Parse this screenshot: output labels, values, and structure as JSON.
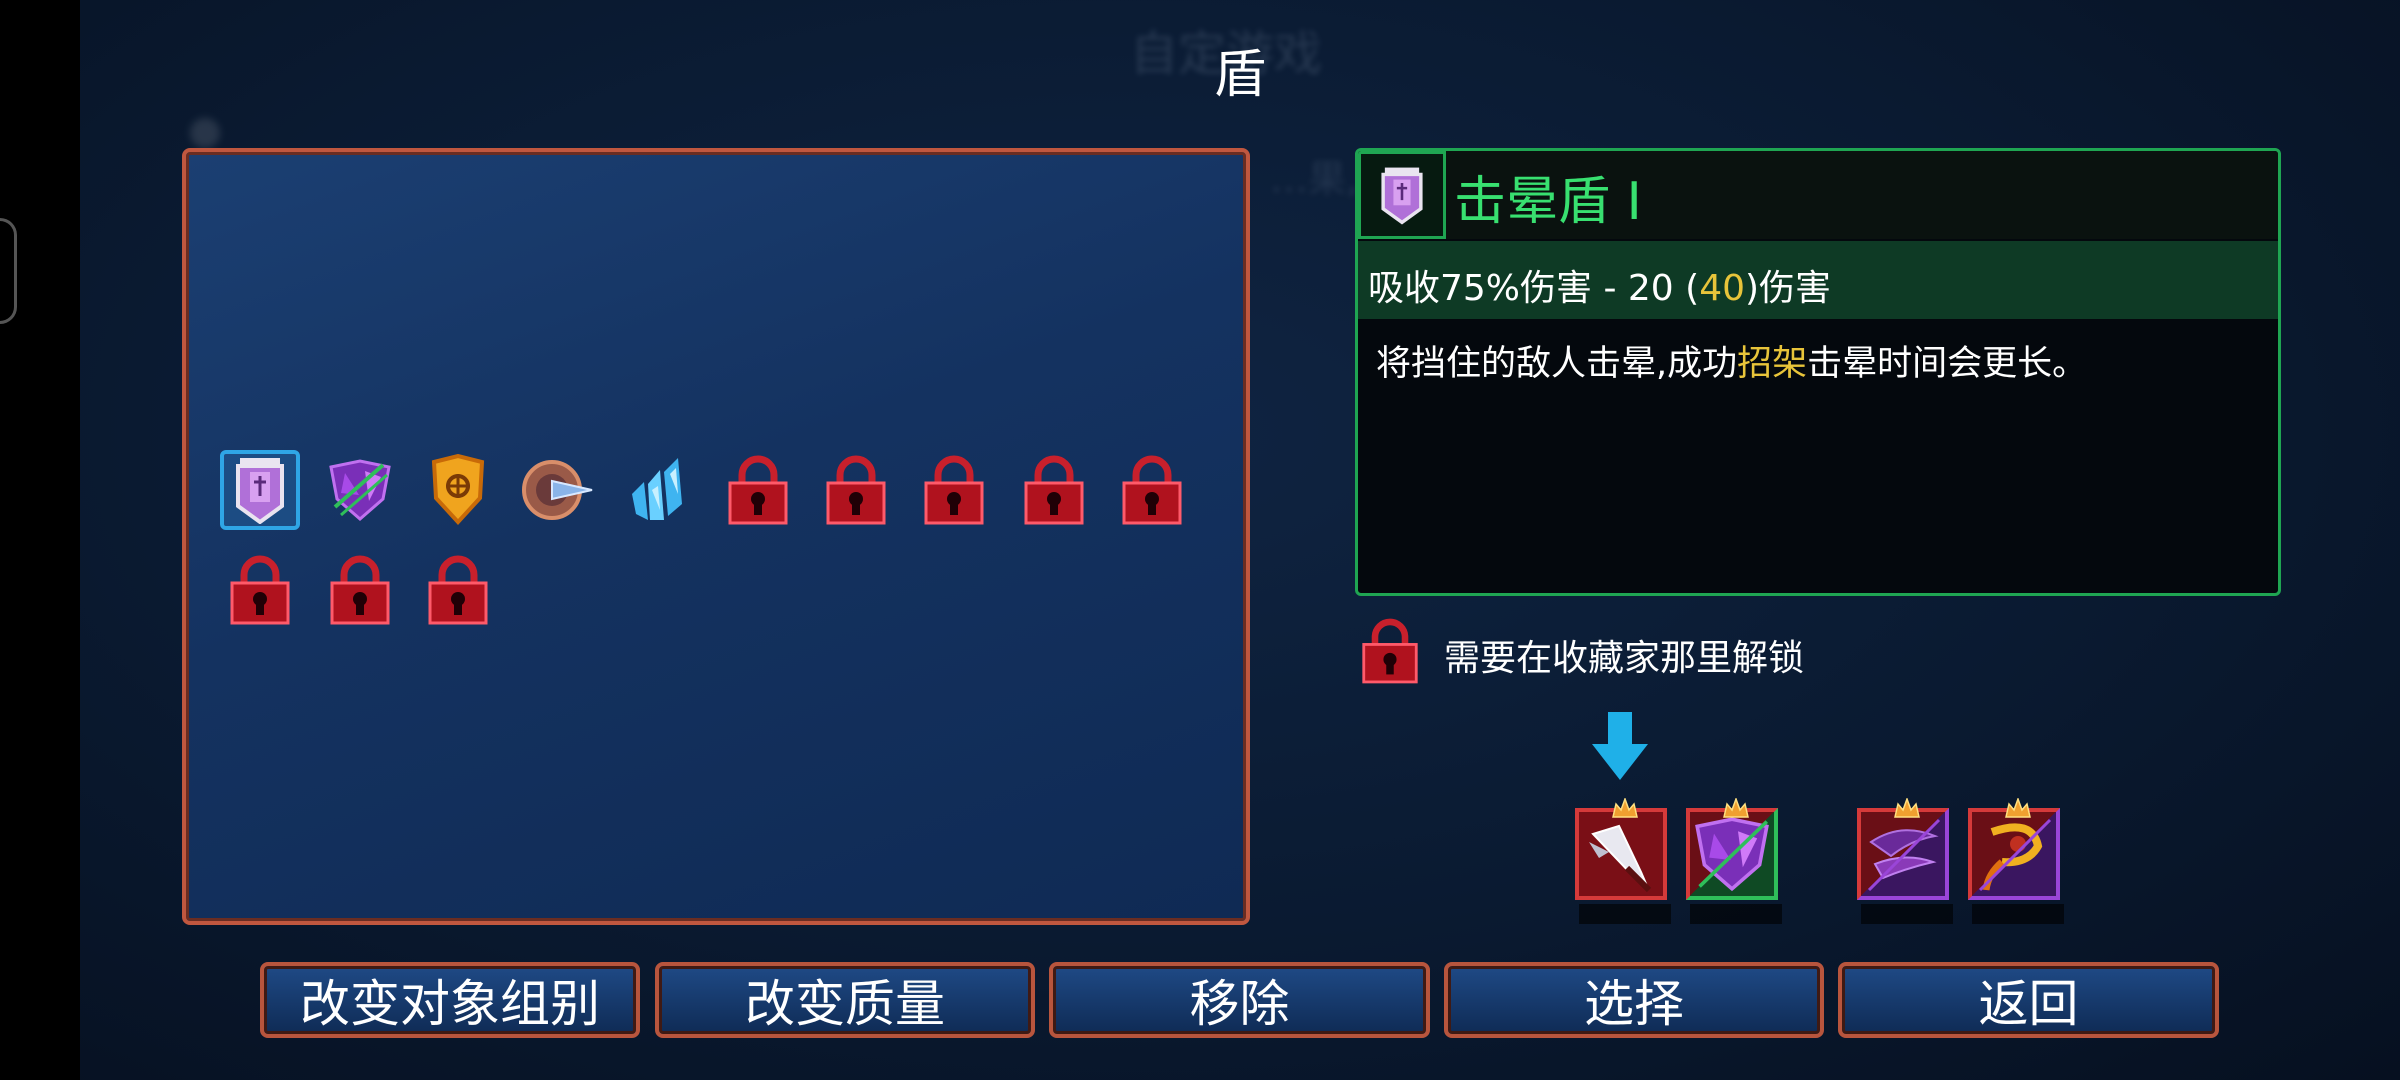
{
  "background": {
    "ghost_title": "自定游戏",
    "ghost_line": "…果,成…  …"
  },
  "title": "盾",
  "inventory": {
    "items": [
      {
        "name": "stun-shield",
        "icon": "purple-banner-shield-icon",
        "selected": true
      },
      {
        "name": "purple-crystal-shield",
        "icon": "purple-heart-shield-icon"
      },
      {
        "name": "gold-parry-shield",
        "icon": "gold-shield-icon"
      },
      {
        "name": "spiked-round-shield",
        "icon": "spiked-buckler-icon"
      },
      {
        "name": "ice-crystal-shield",
        "icon": "ice-crystal-icon"
      },
      {
        "name": "locked",
        "icon": "padlock-icon"
      },
      {
        "name": "locked",
        "icon": "padlock-icon"
      },
      {
        "name": "locked",
        "icon": "padlock-icon"
      },
      {
        "name": "locked",
        "icon": "padlock-icon"
      },
      {
        "name": "locked",
        "icon": "padlock-icon"
      },
      {
        "name": "locked",
        "icon": "padlock-icon"
      },
      {
        "name": "locked",
        "icon": "padlock-icon"
      },
      {
        "name": "locked",
        "icon": "padlock-icon"
      }
    ]
  },
  "info": {
    "name": "击晕盾 Ⅰ",
    "stat_prefix": "吸收75%伤害 - 20 (",
    "stat_highlight": "40",
    "stat_suffix": ")伤害",
    "desc_prefix": "将挡住的敌人击晕,成功",
    "desc_highlight": "招架",
    "desc_suffix": "击晕时间会更长。"
  },
  "unlock_text": "需要在收藏家那里解锁",
  "combos": [
    {
      "icon": "blade-icon",
      "border": "#d53a3a"
    },
    {
      "icon": "purple-heart-shield-icon",
      "border": "#d53a3a",
      "border2": "#2fbf5a"
    },
    {
      "icon": "purple-blade-icon",
      "border": "#d53a3a",
      "border2": "#9a45d8"
    },
    {
      "icon": "gold-whip-icon",
      "border": "#d53a3a",
      "border2": "#9a45d8"
    }
  ],
  "buttons": {
    "change_group": "改变对象组别",
    "change_quality": "改变质量",
    "remove": "移除",
    "select": "选择",
    "back": "返回"
  },
  "colors": {
    "accent_green": "#38e070",
    "highlight_yellow": "#e8c43a",
    "panel_border": "#c0573f",
    "lock_red": "#c8202c"
  }
}
